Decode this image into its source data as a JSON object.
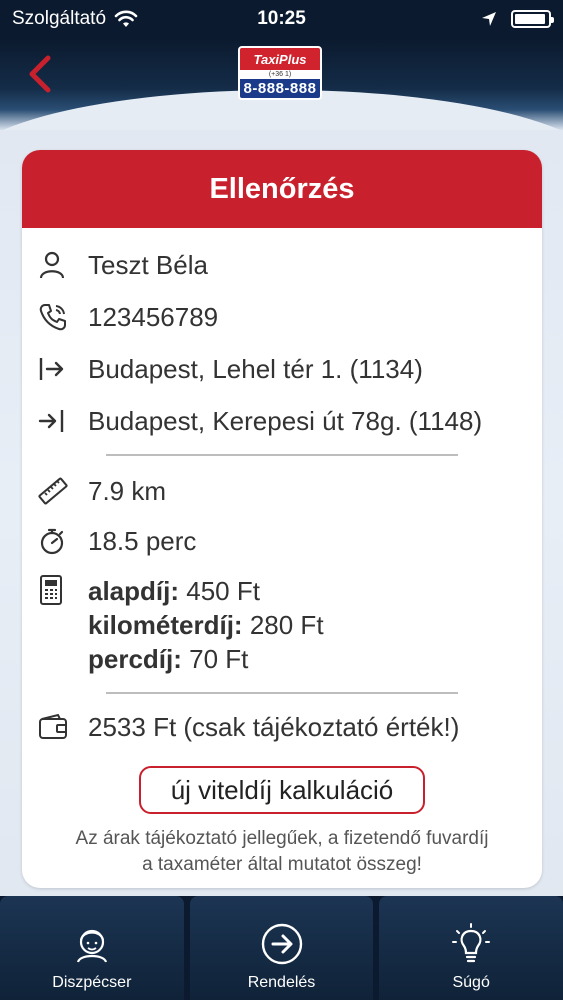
{
  "status_bar": {
    "carrier": "Szolgáltató",
    "time": "10:25",
    "battery_level": 0.95
  },
  "header": {
    "logo": {
      "brand": "TaxiPlus",
      "prefix": "(+36 1)",
      "phone": "8-888-888"
    }
  },
  "card": {
    "title": "Ellenőrzés",
    "name": "Teszt Béla",
    "phone": "123456789",
    "from": "Budapest, Lehel tér 1. (1134)",
    "to": "Budapest, Kerepesi út 78g. (1148)",
    "distance": "7.9 km",
    "duration": "18.5 perc",
    "fees": [
      {
        "label": "alapdíj:",
        "value": "450 Ft"
      },
      {
        "label": "kilométerdíj:",
        "value": "280 Ft"
      },
      {
        "label": "percdíj:",
        "value": "70 Ft"
      }
    ],
    "total": "2533 Ft (csak tájékoztató érték!)",
    "recalc_button": "új viteldíj kalkuláció",
    "note_line1": "Az árak tájékoztató jellegűek, a fizetendő fuvardíj",
    "note_line2": "a taxaméter által mutatot összeg!"
  },
  "bottom_nav": [
    {
      "label": "Diszpécser",
      "icon": "dispatcher-icon"
    },
    {
      "label": "Rendelés",
      "icon": "arrow-right-circle-icon"
    },
    {
      "label": "Súgó",
      "icon": "lightbulb-icon"
    }
  ],
  "colors": {
    "brand_red": "#c8202c",
    "navy": "#0b1a2e"
  }
}
